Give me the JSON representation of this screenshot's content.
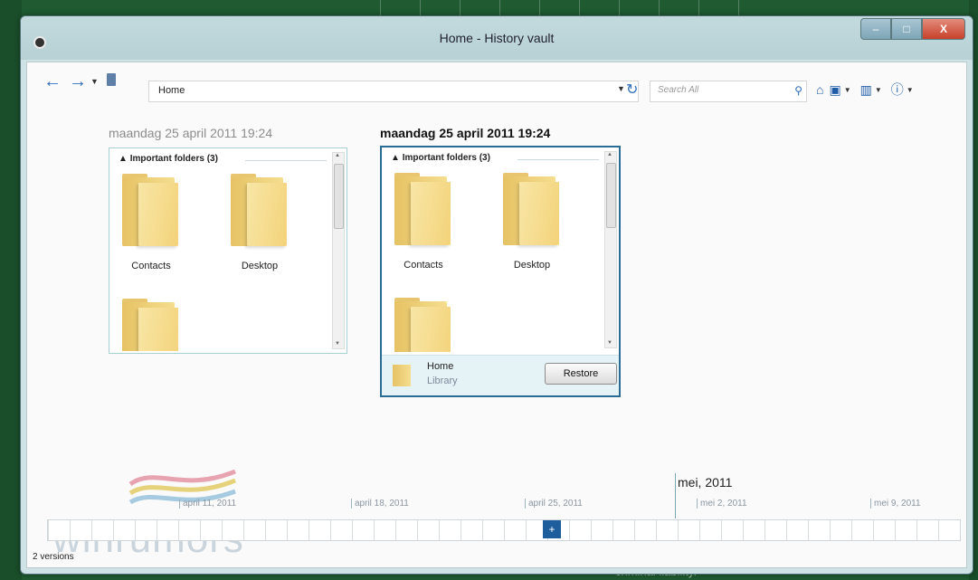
{
  "window": {
    "title": "Home - History vault",
    "controls": {
      "minimize": "–",
      "maximize": "□",
      "close": "X"
    }
  },
  "toolbar": {
    "address": "Home",
    "search_placeholder": "Search All",
    "icons": [
      "back-arrow-icon",
      "forward-arrow-icon",
      "up-icon",
      "refresh-icon",
      "search-icon",
      "home-icon",
      "image-icon",
      "columns-icon",
      "help-icon"
    ]
  },
  "snapshots": [
    {
      "date_label": "maandag 25 april 2011 19:24",
      "group_label": "Important folders (3)",
      "folders": [
        "Contacts",
        "Desktop",
        ""
      ]
    },
    {
      "date_label": "maandag 25 april 2011 19:24",
      "group_label": "Important folders (3)",
      "folders": [
        "Contacts",
        "Desktop",
        ""
      ],
      "detail": {
        "name": "Home",
        "type": "Library",
        "restore_label": "Restore"
      }
    }
  ],
  "timeline": {
    "month_label": "mei, 2011",
    "weeks": [
      "april 11, 2011",
      "april 18, 2011",
      "april 25, 2011",
      "mei 2, 2011",
      "mei 9, 2011"
    ],
    "marker_label": "+"
  },
  "watermark": {
    "text": "winrumors"
  },
  "status": {
    "versions": "2 versions"
  },
  "desktop": {
    "bottom_text": "criminal liability."
  },
  "colors": {
    "accent": "#1f5e9c",
    "selection_border": "#2b6c96",
    "desktop": "#1f5a30"
  }
}
